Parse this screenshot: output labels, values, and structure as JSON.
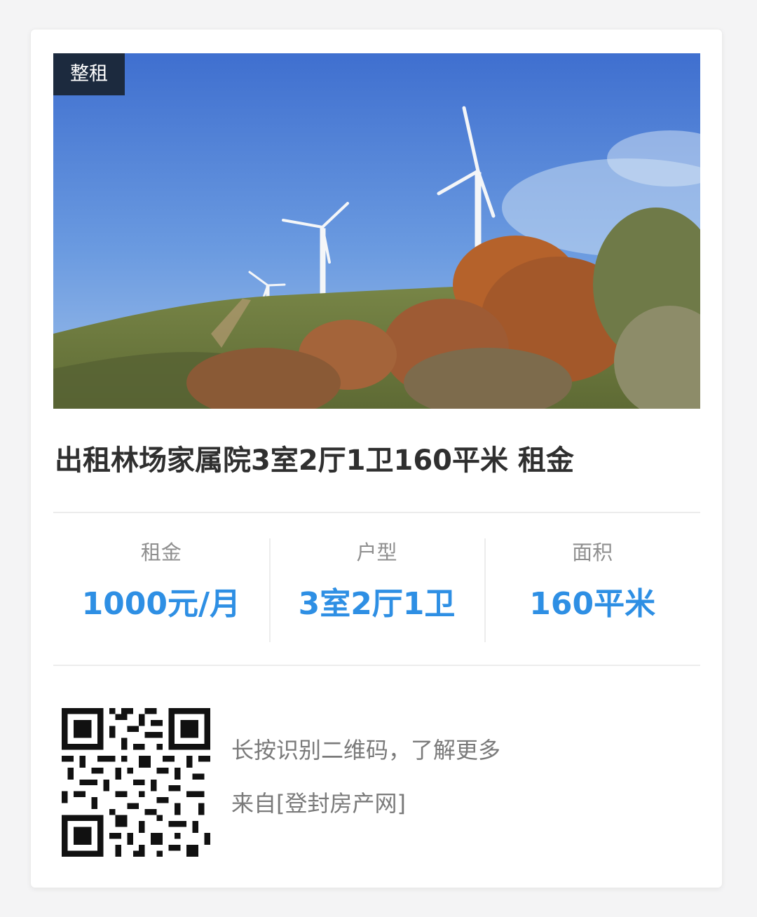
{
  "listing": {
    "badge": "整租",
    "title": "出租林场家属院3室2厅1卫160平米 租金",
    "photo": "wind-turbines-on-hill-photo"
  },
  "stats": [
    {
      "label": "租金",
      "value": "1000元/月"
    },
    {
      "label": "户型",
      "value": "3室2厅1卫"
    },
    {
      "label": "面积",
      "value": "160平米"
    }
  ],
  "footer": {
    "qr_icon": "qr-code-icon",
    "hint": "长按识别二维码，了解更多",
    "source": "来自[登封房产网]"
  },
  "colors": {
    "accent": "#2e8fe4",
    "badge_bg": "#1c2a3e",
    "title": "#2f2f2f",
    "label": "#8f8f8f"
  }
}
